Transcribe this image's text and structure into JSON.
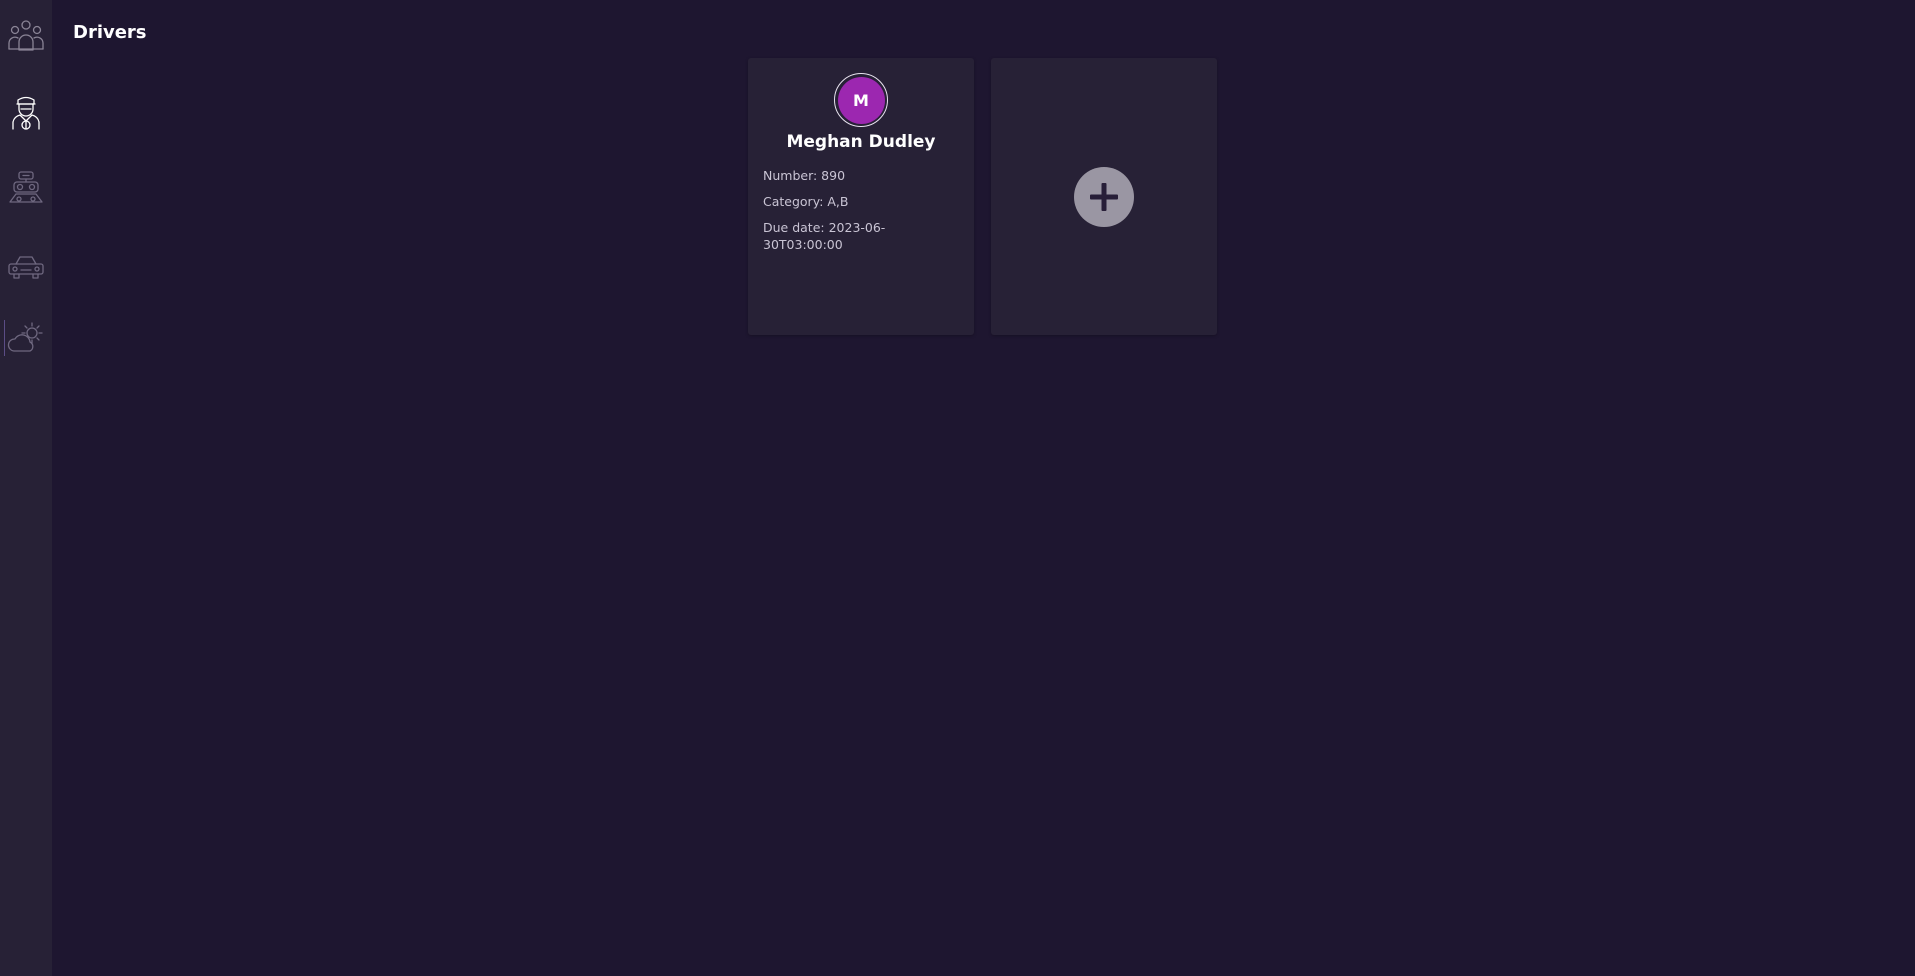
{
  "page": {
    "title": "Drivers"
  },
  "sidebar": {
    "items": [
      {
        "name": "users",
        "icon": "users-group-icon"
      },
      {
        "name": "drivers",
        "icon": "driver-icon",
        "active": true
      },
      {
        "name": "mechanics",
        "icon": "robot-wheels-icon"
      },
      {
        "name": "vehicles",
        "icon": "car-icon"
      },
      {
        "name": "weather",
        "icon": "weather-cloud-sun-icon"
      }
    ]
  },
  "drivers": [
    {
      "initial": "M",
      "name": "Meghan Dudley",
      "number": "Number: 890",
      "category": "Category: A,B",
      "due_date": "Due date: 2023-06-30T03:00:00",
      "avatar_color": "#9c27b0"
    }
  ],
  "add_card": {
    "icon": "plus-icon"
  },
  "colors": {
    "background": "#1e1630",
    "surface": "#272136",
    "accent": "#9c27b0",
    "add_button": "#9a96a3"
  }
}
